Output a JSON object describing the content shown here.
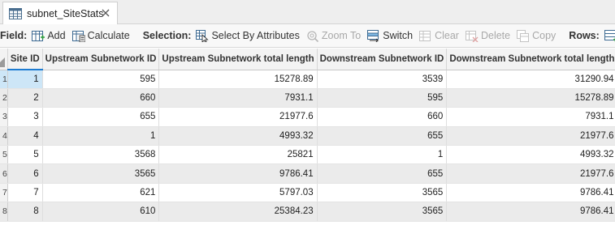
{
  "tab": {
    "title": "subnet_SiteStats"
  },
  "toolbar": {
    "field_label": "Field:",
    "add_label": "Add",
    "calculate_label": "Calculate",
    "selection_label": "Selection:",
    "select_by_attributes_label": "Select By Attributes",
    "zoom_to_label": "Zoom To",
    "switch_label": "Switch",
    "clear_label": "Clear",
    "delete_label": "Delete",
    "copy_label": "Copy",
    "rows_label": "Rows:"
  },
  "table": {
    "columns": [
      "Site ID",
      "Upstream Subnetwork ID",
      "Upstream Subnetwork total length",
      "Downstream Subnetwork ID",
      "Downstream Subnetwork total length"
    ],
    "rows": [
      [
        "1",
        "1",
        "595",
        "15278.89",
        "3539",
        "31290.94"
      ],
      [
        "2",
        "2",
        "660",
        "7931.1",
        "595",
        "15278.89"
      ],
      [
        "3",
        "3",
        "655",
        "21977.6",
        "660",
        "7931.1"
      ],
      [
        "4",
        "4",
        "1",
        "4993.32",
        "655",
        "21977.6"
      ],
      [
        "5",
        "5",
        "3568",
        "25821",
        "1",
        "4993.32"
      ],
      [
        "6",
        "6",
        "3565",
        "9786.41",
        "655",
        "21977.6"
      ],
      [
        "7",
        "7",
        "621",
        "5797.03",
        "3565",
        "9786.41"
      ],
      [
        "8",
        "8",
        "610",
        "25384.23",
        "3565",
        "9786.41"
      ]
    ]
  },
  "colors": {
    "accent": "#1d7bd1",
    "selected": "#cde6f7"
  }
}
